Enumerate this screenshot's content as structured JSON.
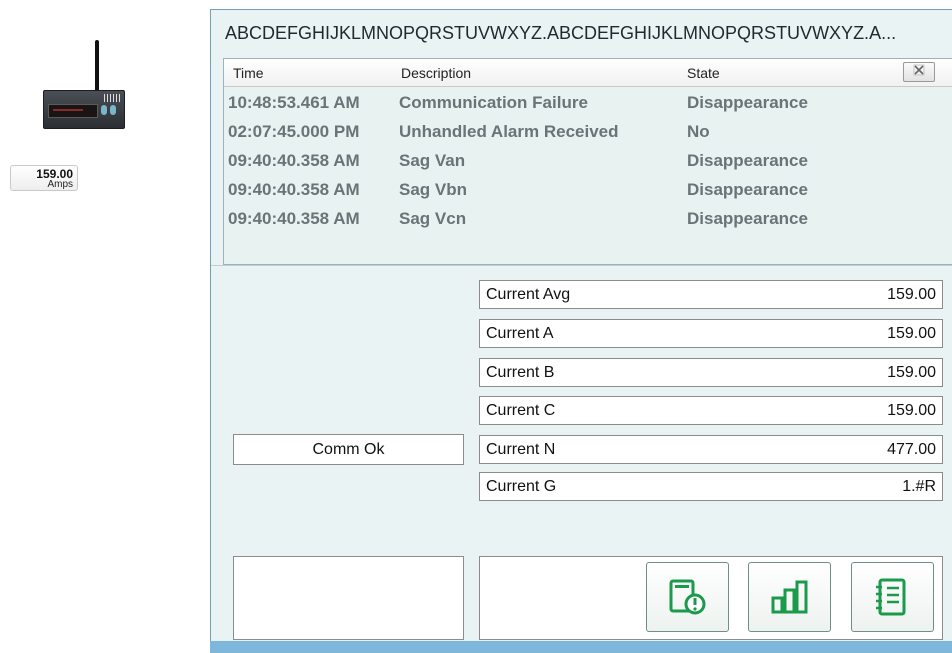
{
  "device": {
    "readout_value": "159.00",
    "readout_unit": "Amps"
  },
  "panel": {
    "title": "ABCDEFGHIJKLMNOPQRSTUVWXYZ.ABCDEFGHIJKLMNOPQRSTUVWXYZ.A..."
  },
  "alarms": {
    "columns": [
      "Time",
      "Description",
      "State"
    ],
    "close_icon": "close-icon",
    "rows": [
      {
        "time": "10:48:53.461 AM",
        "description": "Communication Failure",
        "state": "Disappearance"
      },
      {
        "time": "02:07:45.000 PM",
        "description": "Unhandled Alarm Received",
        "state": "No"
      },
      {
        "time": "09:40:40.358 AM",
        "description": "Sag Van",
        "state": "Disappearance"
      },
      {
        "time": "09:40:40.358 AM",
        "description": "Sag Vbn",
        "state": "Disappearance"
      },
      {
        "time": "09:40:40.358 AM",
        "description": "Sag Vcn",
        "state": "Disappearance"
      }
    ]
  },
  "measurements": [
    {
      "label": "Current Avg",
      "value": "159.00"
    },
    {
      "label": "Current A",
      "value": "159.00"
    },
    {
      "label": "Current B",
      "value": "159.00"
    },
    {
      "label": "Current C",
      "value": "159.00"
    },
    {
      "label": "Current N",
      "value": "477.00"
    },
    {
      "label": "Current G",
      "value": "1.#R"
    }
  ],
  "status": "Comm Ok",
  "toolbar": {
    "buttons": [
      {
        "icon": "alarm-device-icon"
      },
      {
        "icon": "bar-chart-icon"
      },
      {
        "icon": "notebook-icon"
      }
    ],
    "accent_color": "#1a9a4a"
  }
}
